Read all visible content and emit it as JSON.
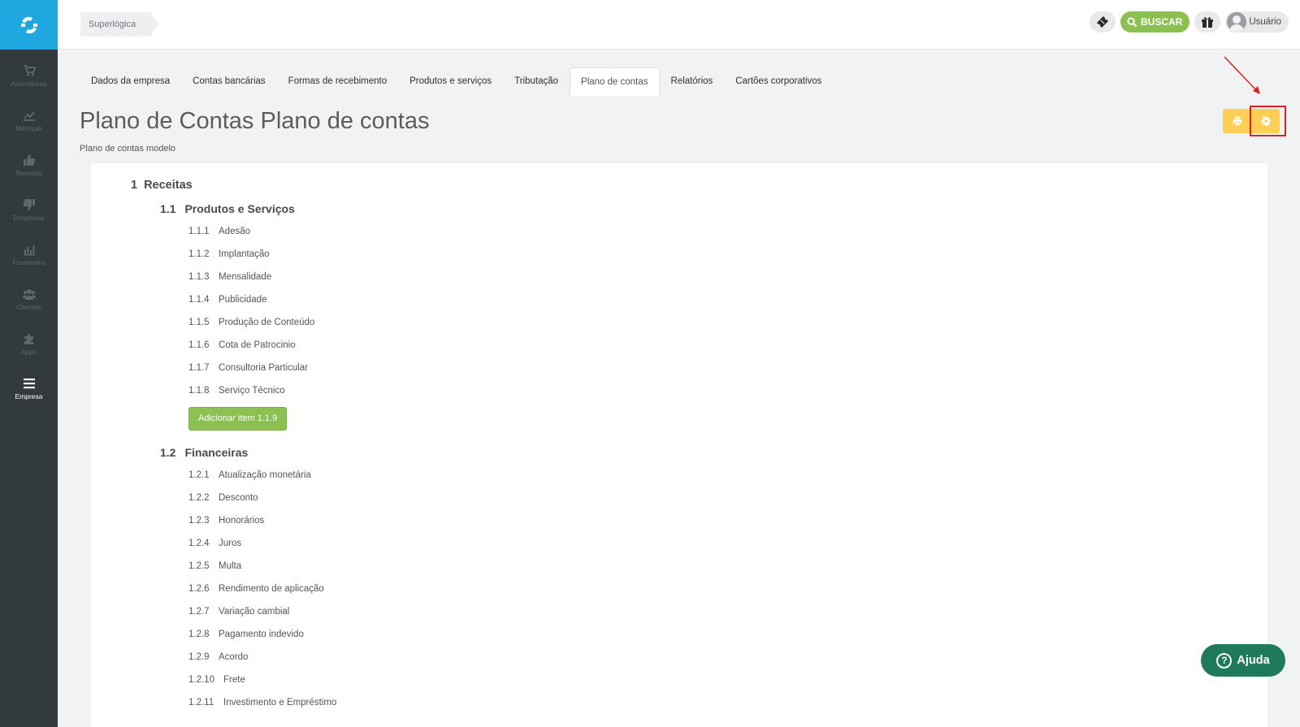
{
  "sidebar": {
    "logo_icon": "superlogica-logo-icon",
    "items": [
      {
        "label": "Assinaturas",
        "icon": "cart-icon"
      },
      {
        "label": "Métricas",
        "icon": "line-chart-icon"
      },
      {
        "label": "Receitas",
        "icon": "thumbs-up-icon"
      },
      {
        "label": "Despesas",
        "icon": "thumbs-down-icon"
      },
      {
        "label": "Financeiro",
        "icon": "bar-chart-icon"
      },
      {
        "label": "Clientes",
        "icon": "users-icon"
      },
      {
        "label": "Apps",
        "icon": "puzzle-icon"
      },
      {
        "label": "Empresa",
        "icon": "menu-icon",
        "active": true
      }
    ]
  },
  "topbar": {
    "breadcrumb": "Superlógica",
    "search_label": "BUSCAR",
    "user_label": "Usuário"
  },
  "tabs": [
    {
      "label": "Dados da empresa"
    },
    {
      "label": "Contas bancárias"
    },
    {
      "label": "Formas de recebimento"
    },
    {
      "label": "Produtos e serviços"
    },
    {
      "label": "Tributação"
    },
    {
      "label": "Plano de contas",
      "active": true
    },
    {
      "label": "Relatórios"
    },
    {
      "label": "Cartões corporativos"
    }
  ],
  "page": {
    "title": "Plano de Contas Plano de contas",
    "subtitle": "Plano de contas modelo"
  },
  "accounts": {
    "receitas": {
      "num": "1",
      "label": "Receitas"
    },
    "produtos": {
      "num": "1.1",
      "label": "Produtos e Serviços",
      "items": [
        {
          "num": "1.1.1",
          "label": "Adesão"
        },
        {
          "num": "1.1.2",
          "label": "Implantação"
        },
        {
          "num": "1.1.3",
          "label": "Mensalidade"
        },
        {
          "num": "1.1.4",
          "label": "Publicidade"
        },
        {
          "num": "1.1.5",
          "label": "Produção de Conteúdo"
        },
        {
          "num": "1.1.6",
          "label": "Cota de Patrocinio"
        },
        {
          "num": "1.1.7",
          "label": "Consultoria Particular"
        },
        {
          "num": "1.1.8",
          "label": "Serviço Técnico"
        }
      ],
      "add_label": "Adicionar item 1.1.9"
    },
    "financeiras": {
      "num": "1.2",
      "label": "Financeiras",
      "items": [
        {
          "num": "1.2.1",
          "label": "Atualização monetária"
        },
        {
          "num": "1.2.2",
          "label": "Desconto"
        },
        {
          "num": "1.2.3",
          "label": "Honorários"
        },
        {
          "num": "1.2.4",
          "label": "Juros"
        },
        {
          "num": "1.2.5",
          "label": "Multa"
        },
        {
          "num": "1.2.6",
          "label": "Rendimento de aplicação"
        },
        {
          "num": "1.2.7",
          "label": "Variação cambial"
        },
        {
          "num": "1.2.8",
          "label": "Pagamento indevido"
        },
        {
          "num": "1.2.9",
          "label": "Acordo"
        },
        {
          "num": "1.2.10",
          "label": "Frete"
        },
        {
          "num": "1.2.11",
          "label": "Investimento e Empréstimo"
        }
      ]
    }
  },
  "help": {
    "label": "Ajuda"
  },
  "colors": {
    "accent_green": "#8cc152",
    "sidebar_bg": "#333a3e",
    "logo_blue": "#1fa8e0",
    "action_yellow": "#ffce54",
    "annotation_red": "#e02020",
    "help_green": "#1e7a5a"
  }
}
